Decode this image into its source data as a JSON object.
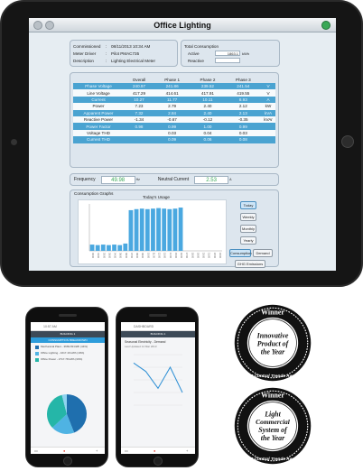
{
  "dashboard": {
    "title": "Office Lighting",
    "info": {
      "commissioned_label": "Commissioned",
      "commissioned_value": "08/11/2013 10:34 AM",
      "meter_label": "Meter Driver",
      "meter_value": "Pilot PMAC735",
      "desc_label": "Description",
      "desc_value": "Lighting Electrical Meter"
    },
    "consumption": {
      "title": "Total Consumption",
      "active_label": "Active",
      "active_value": "1863.1",
      "active_unit": "kWh",
      "reactive_label": "Reactive",
      "reactive_value": "",
      "reactive_unit": ""
    },
    "table": {
      "headers": [
        "",
        "Overall",
        "Phase 1",
        "Phase 2",
        "Phase 3",
        ""
      ],
      "rows": [
        {
          "name": "Phase Voltage",
          "overall": "240.97",
          "p1": "241.86",
          "p2": "239.52",
          "p3": "241.54",
          "unit": "V",
          "style": "blue"
        },
        {
          "name": "Line Voltage",
          "overall": "417.29",
          "p1": "414.61",
          "p2": "417.91",
          "p3": "419.55",
          "unit": "V",
          "style": "white"
        },
        {
          "name": "Current",
          "overall": "10.27",
          "p1": "11.77",
          "p2": "10.11",
          "p3": "8.93",
          "unit": "A",
          "style": "blue"
        },
        {
          "name": "Power",
          "overall": "7.23",
          "p1": "2.79",
          "p2": "2.40",
          "p3": "2.12",
          "unit": "kW",
          "style": "white"
        },
        {
          "name": "Apparent Power",
          "overall": "7.32",
          "p1": "2.84",
          "p2": "2.40",
          "p3": "2.13",
          "unit": "kVA",
          "style": "blue"
        },
        {
          "name": "Reactive Power",
          "overall": "-1.34",
          "p1": "-0.67",
          "p2": "-0.12",
          "p3": "-0.35",
          "unit": "kVAr",
          "style": "white"
        },
        {
          "name": "Power Factor",
          "overall": "0.98",
          "p1": "0.99",
          "p2": "1.00",
          "p3": "0.99",
          "unit": "",
          "style": "blue"
        },
        {
          "name": "Voltage THD",
          "overall": "",
          "p1": "0.03",
          "p2": "0.04",
          "p3": "0.03",
          "unit": "",
          "style": "white"
        },
        {
          "name": "Current THD",
          "overall": "",
          "p1": "0.09",
          "p2": "0.06",
          "p3": "0.08",
          "unit": "",
          "style": "blue"
        }
      ]
    },
    "frequency_label": "Frequency",
    "frequency_value": "49.98",
    "frequency_unit": "Hz",
    "neutral_label": "Neutral Current",
    "neutral_value": "2.53",
    "neutral_unit": "A",
    "graphs_title": "Consumption Graphs",
    "chart_title": "Today's Usage",
    "period_buttons": [
      "Today",
      "Weekly",
      "Monthly",
      "Yearly"
    ],
    "mode_buttons": [
      "Consumption",
      "Demand"
    ],
    "co2_button": "GHG Emissions",
    "colors": {
      "accent": "#4aa3d1",
      "green": "#3aa857"
    }
  },
  "chart_data": {
    "type": "bar",
    "title": "Today's Usage",
    "categories": [
      "00:00",
      "01:00",
      "02:00",
      "03:00",
      "04:00",
      "05:00",
      "06:00",
      "07:00",
      "08:00",
      "09:00",
      "10:00",
      "11:00",
      "12:00",
      "13:00",
      "14:00",
      "15:00",
      "16:00",
      "17:00",
      "18:00",
      "19:00",
      "20:00",
      "21:00",
      "22:00",
      "23:00"
    ],
    "values": [
      1.2,
      1.1,
      1.2,
      1.1,
      1.2,
      1.1,
      1.4,
      7.8,
      8.0,
      8.1,
      8.0,
      8.1,
      8.2,
      8.1,
      8.0,
      8.1,
      8.3,
      0,
      0,
      0,
      0,
      0,
      0,
      0
    ],
    "ylim": [
      0,
      9
    ]
  },
  "phone1": {
    "header": "10:57 AM",
    "building": "BUILDING 1",
    "tab": "CONSUMPTION BREAKDOWN",
    "items": [
      {
        "label": "Mechanical Plant - 3669.89 kWh (44%)",
        "color": "#1f6fae"
      },
      {
        "label": "Office Lighting - 1617.16 kWh (19%)",
        "color": "#4fb3e3"
      },
      {
        "label": "Office Power - 2717.78 kWh (33%)",
        "color": "#25b6a8"
      }
    ],
    "pie": [
      44,
      19,
      33,
      4
    ]
  },
  "phone2": {
    "header": "DASHBOARD",
    "building": "BUILDING 1",
    "chart_title": "Seasonal Electricity - Demand",
    "chart_sub": "Last Updated 14 Mar 2013",
    "line_values": [
      5,
      4,
      2,
      4.5,
      1.5
    ]
  },
  "badges": [
    {
      "top": "Winner",
      "lines": [
        "Innovative",
        "Product of",
        "the Year"
      ],
      "ring": "2017 Control Trends Awards"
    },
    {
      "top": "Winner",
      "lines": [
        "Light",
        "Commercial",
        "System of",
        "the Year"
      ],
      "ring": "2017 Control Trends Awards"
    }
  ]
}
